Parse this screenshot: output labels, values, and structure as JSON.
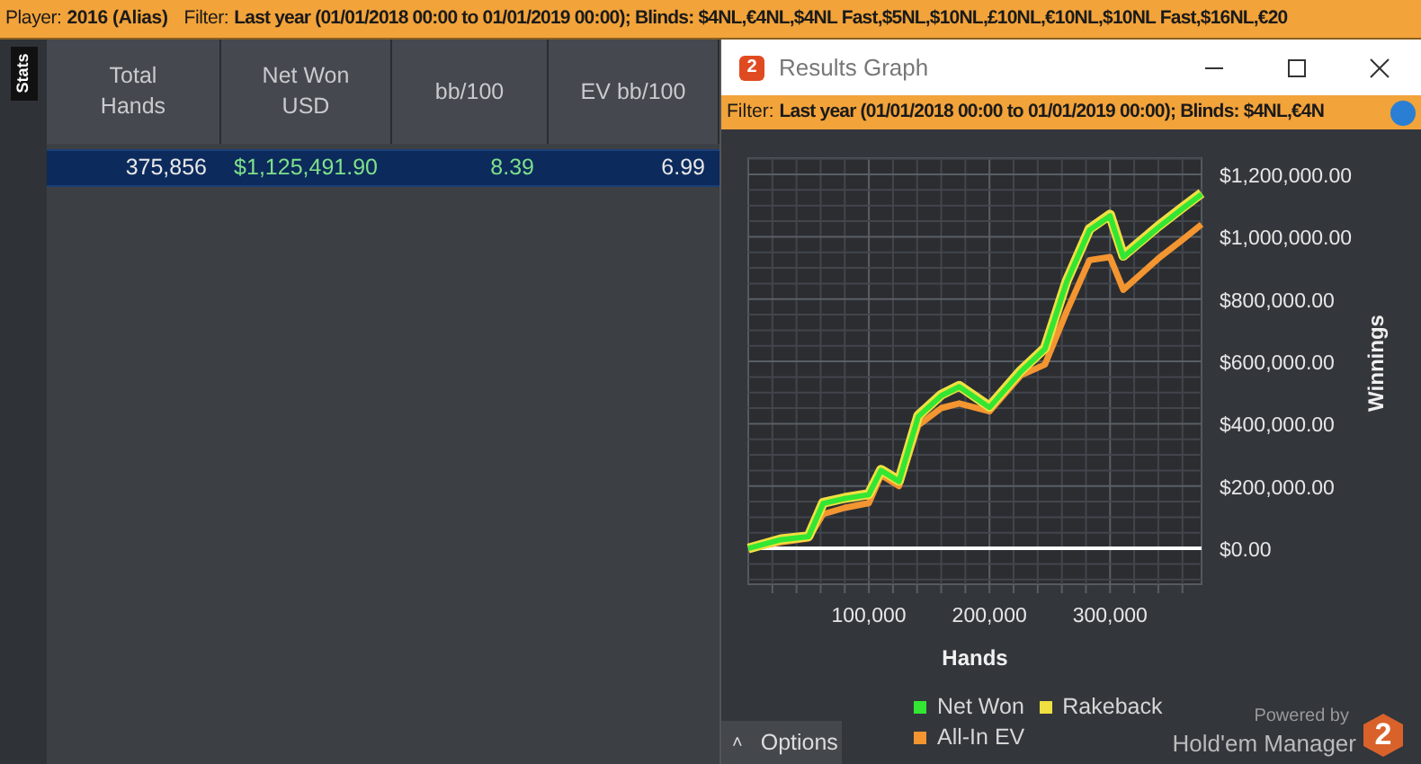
{
  "filter_bar": {
    "player_label": "Player:",
    "player": "2016 (Alias)",
    "filter_label": "Filter:",
    "filter": "Last year (01/01/2018 00:00 to 01/01/2019 00:00); Blinds: $4NL,€4NL,$4NL Fast,$5NL,$10NL,£10NL,€10NL,$10NL Fast,$16NL,€20"
  },
  "stats_tab": {
    "label": "Stats",
    "selected": true
  },
  "table": {
    "columns": [
      "Total Hands",
      "Net Won USD",
      "bb/100",
      "EV bb/100"
    ],
    "rows": [
      {
        "selected": true,
        "cells": [
          "375,856",
          "$1,125,491.90",
          "8.39",
          "6.99"
        ]
      }
    ]
  },
  "graph_window": {
    "title": "Results Graph",
    "filter_label": "Filter:",
    "filter": "Last year (01/01/2018 00:00 to 01/01/2019 00:00); Blinds: $4NL,€4N",
    "chart_data": {
      "type": "line",
      "grid": true,
      "xlabel": "Hands",
      "ylabel": "Winnings",
      "x": [
        0,
        27000,
        50000,
        62000,
        80000,
        100000,
        110000,
        125000,
        141000,
        160000,
        175000,
        200000,
        226000,
        246000,
        264000,
        283000,
        300000,
        311000,
        340000,
        360000,
        375856
      ],
      "series": [
        {
          "name": "Net Won",
          "color": "#33e633",
          "values": [
            0,
            28000,
            38000,
            144000,
            160000,
            172000,
            250000,
            215000,
            423000,
            490000,
            519000,
            452000,
            567000,
            640000,
            855000,
            1021000,
            1067000,
            935000,
            1030000,
            1090000,
            1136000
          ]
        },
        {
          "name": "Rakeback",
          "color": "#f0e040",
          "values": [
            0,
            29000,
            39000,
            146000,
            162000,
            174000,
            252000,
            217000,
            426000,
            493000,
            522000,
            455000,
            570000,
            643000,
            858000,
            1025000,
            1071000,
            939000,
            1034000,
            1094000,
            1140000
          ]
        },
        {
          "name": "All-In EV",
          "color": "#f39530",
          "values": [
            0,
            20000,
            32000,
            110000,
            130000,
            145000,
            235000,
            200000,
            395000,
            450000,
            465000,
            440000,
            555000,
            590000,
            760000,
            925000,
            935000,
            830000,
            930000,
            990000,
            1040000
          ]
        }
      ],
      "xlim": [
        0,
        375856
      ],
      "ylim": [
        -115000,
        1252000
      ],
      "xticks": [
        {
          "value": 100000,
          "label": "100,000"
        },
        {
          "value": 200000,
          "label": "200,000"
        },
        {
          "value": 300000,
          "label": "300,000"
        }
      ],
      "yticks": [
        {
          "value": 0,
          "label": "$0.00"
        },
        {
          "value": 200000,
          "label": "$200,000.00"
        },
        {
          "value": 400000,
          "label": "$400,000.00"
        },
        {
          "value": 600000,
          "label": "$600,000.00"
        },
        {
          "value": 800000,
          "label": "$800,000.00"
        },
        {
          "value": 1000000,
          "label": "$1,000,000.00"
        },
        {
          "value": 1200000,
          "label": "$1,200,000.00"
        }
      ]
    },
    "options_button": "Options",
    "options_caret": "˄",
    "powered_by": "Powered by",
    "brand": "Hold'em Manager",
    "brand_logo": "2",
    "window_logo": "2"
  }
}
